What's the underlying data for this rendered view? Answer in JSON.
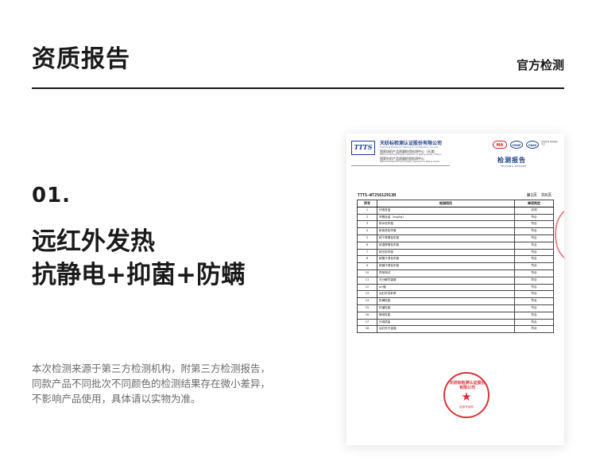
{
  "header": {
    "title": "资质报告",
    "tag": "官方检测"
  },
  "section": {
    "number": "01.",
    "title_lines": [
      "远红外发热",
      "抗静电+抑菌+防螨"
    ],
    "description_lines": [
      "本次检测来源于第三方检测机构，附第三方检测报告，",
      "同款产品不同批次不同颜色的检测结果存在微小差异，",
      "不影响产品使用，具体请以实物为准。"
    ]
  },
  "report": {
    "logo": "TTTS",
    "company": "天纺标检测认证股份有限公司",
    "company_en": "Tianfang Biaozhun Testing & Certification Co.,Ltd",
    "center1": "国家纺织产品质量检验检测中心（天津）",
    "center1_en": "National Clothing Quality Inspection & Testing Center (Tianjin)",
    "center2": "国家针织产品质量检验检测中心",
    "center2_en": "National Knitted Product Quality Inspection & Testing Center",
    "certs": [
      "MA",
      "CMAF",
      "CNAS"
    ],
    "cert_note": "检验检测 机构资质 认定",
    "title": "检测报告",
    "title_en": "TESTING REPORT",
    "number": "TTTS-WT25612913H",
    "page_label": "第2页",
    "total_label": "共6页",
    "table": {
      "headers": [
        "序号",
        "检测项目",
        "单项判定"
      ],
      "rows": [
        [
          "1",
          "纤维含量",
          "实测"
        ],
        [
          "2",
          "甲醛含量（mg/kg）",
          "符合"
        ],
        [
          "3",
          "耐水色牢度",
          "符合"
        ],
        [
          "4",
          "耐皂洗色牢度",
          "符合"
        ],
        [
          "5",
          "耐干摩擦色牢度",
          "符合"
        ],
        [
          "6",
          "耐湿摩擦色牢度",
          "符合"
        ],
        [
          "7",
          "耐光色牢度",
          "符合"
        ],
        [
          "8",
          "耐酸汗渍色牢度",
          "符合"
        ],
        [
          "9",
          "耐碱汗渍色牢度",
          "符合"
        ],
        [
          "10",
          "异味测试",
          "符合"
        ],
        [
          "11",
          "可分解芳香胺",
          "符合"
        ],
        [
          "12",
          "pH值",
          "符合"
        ],
        [
          "13",
          "远红外发射率",
          "符合"
        ],
        [
          "14",
          "防螨性能",
          "符合"
        ],
        [
          "15",
          "抗菌性能",
          "符合"
        ],
        [
          "16",
          "静电性能",
          "符合"
        ],
        [
          "17",
          "外观质量",
          "符合"
        ],
        [
          "18",
          "远红外升温值",
          "符合"
        ]
      ]
    },
    "seal": {
      "text": "天纺标检测认证股份有限公司",
      "sub": "检测专用章"
    }
  }
}
